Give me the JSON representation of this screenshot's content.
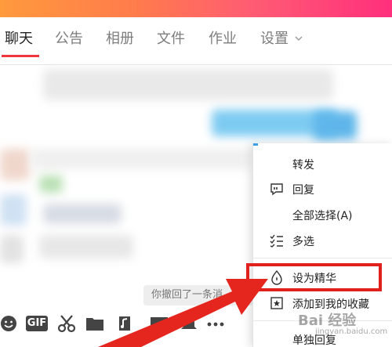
{
  "tabs": [
    {
      "label": "聊天"
    },
    {
      "label": "公告"
    },
    {
      "label": "相册"
    },
    {
      "label": "文件"
    },
    {
      "label": "作业"
    },
    {
      "label": "设置"
    }
  ],
  "context_menu": {
    "items": [
      {
        "label": "转发",
        "icon": "none"
      },
      {
        "label": "回复",
        "icon": "reply-quote-icon"
      },
      {
        "label": "全部选择(A)",
        "icon": "none"
      },
      {
        "label": "多选",
        "icon": "multi-select-icon"
      },
      {
        "label": "设为精华",
        "icon": "essence-drop-icon"
      },
      {
        "label": "添加到我的收藏",
        "icon": "favorite-star-icon"
      },
      {
        "label": "单独回复",
        "icon": "none"
      }
    ]
  },
  "toast": {
    "text": "你撤回了一条消"
  },
  "toolbar": {
    "icons": [
      "emoji-icon",
      "gif-icon",
      "scissors-icon",
      "folder-icon",
      "music-icon",
      "image-icon",
      "bell-icon",
      "more-icon"
    ],
    "gif_label": "GIF"
  },
  "watermark": {
    "brand": "Bai 经验",
    "sub": "jingyan.baidu.com"
  },
  "colors": {
    "accent_red": "#e0201c",
    "tab_underline": "#f0353b",
    "arrow_red": "#e5261f"
  }
}
